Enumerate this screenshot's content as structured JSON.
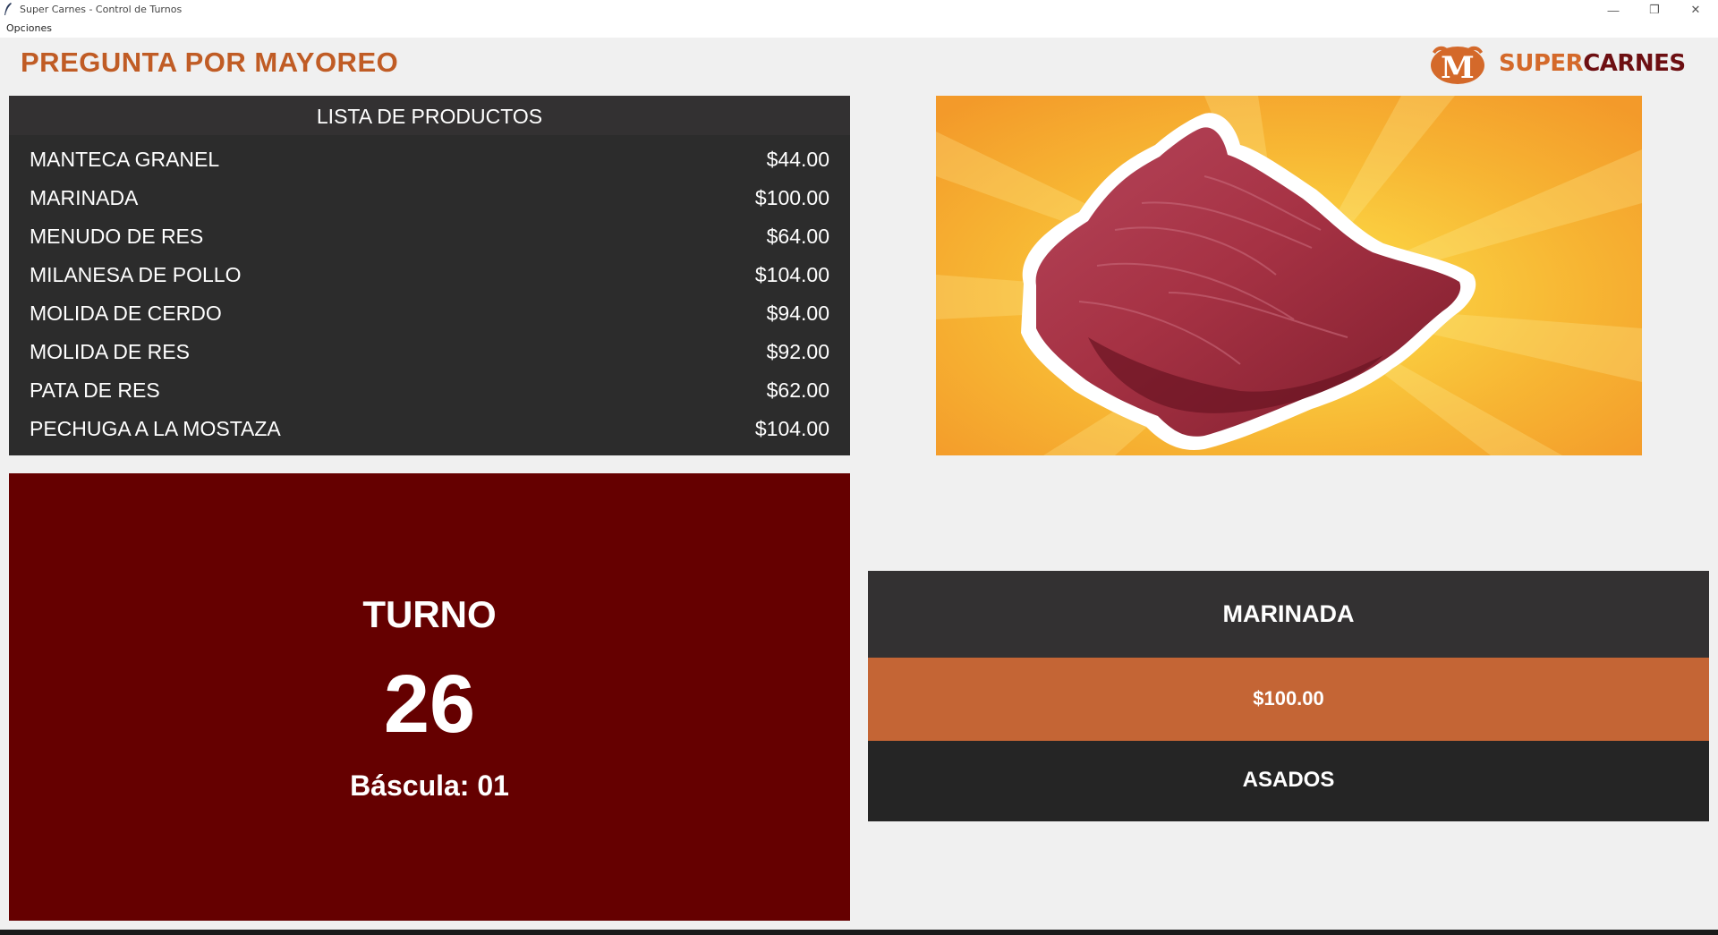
{
  "window": {
    "title": "Super Carnes - Control de Turnos",
    "controls": {
      "minimize": "—",
      "restore": "❐",
      "close": "✕"
    }
  },
  "menu": {
    "items": [
      "Opciones"
    ]
  },
  "promo_text": "PREGUNTA POR MAYOREO",
  "logo": {
    "brand_part1": "SUPER",
    "brand_part2": "CARNES",
    "badge_letter": "M"
  },
  "product_list": {
    "header": "LISTA DE PRODUCTOS",
    "items": [
      {
        "name": "MANTECA GRANEL",
        "price": "$44.00"
      },
      {
        "name": "MARINADA",
        "price": "$100.00"
      },
      {
        "name": "MENUDO DE RES",
        "price": "$64.00"
      },
      {
        "name": "MILANESA DE POLLO",
        "price": "$104.00"
      },
      {
        "name": "MOLIDA DE CERDO",
        "price": "$94.00"
      },
      {
        "name": "MOLIDA DE RES",
        "price": "$92.00"
      },
      {
        "name": "PATA DE RES",
        "price": "$62.00"
      },
      {
        "name": "PECHUGA A LA MOSTAZA",
        "price": "$104.00"
      }
    ]
  },
  "turno": {
    "label": "TURNO",
    "number": "26",
    "bascula": "Báscula: 01"
  },
  "featured": {
    "name": "MARINADA",
    "price": "$100.00",
    "category": "ASADOS"
  },
  "colors": {
    "promo": "#c05c25",
    "list_bg": "#2c2c2c",
    "turno_bg": "#650000",
    "price_bar": "#c46535",
    "logo_orange": "#d4692a",
    "logo_dark": "#6d0f12"
  }
}
